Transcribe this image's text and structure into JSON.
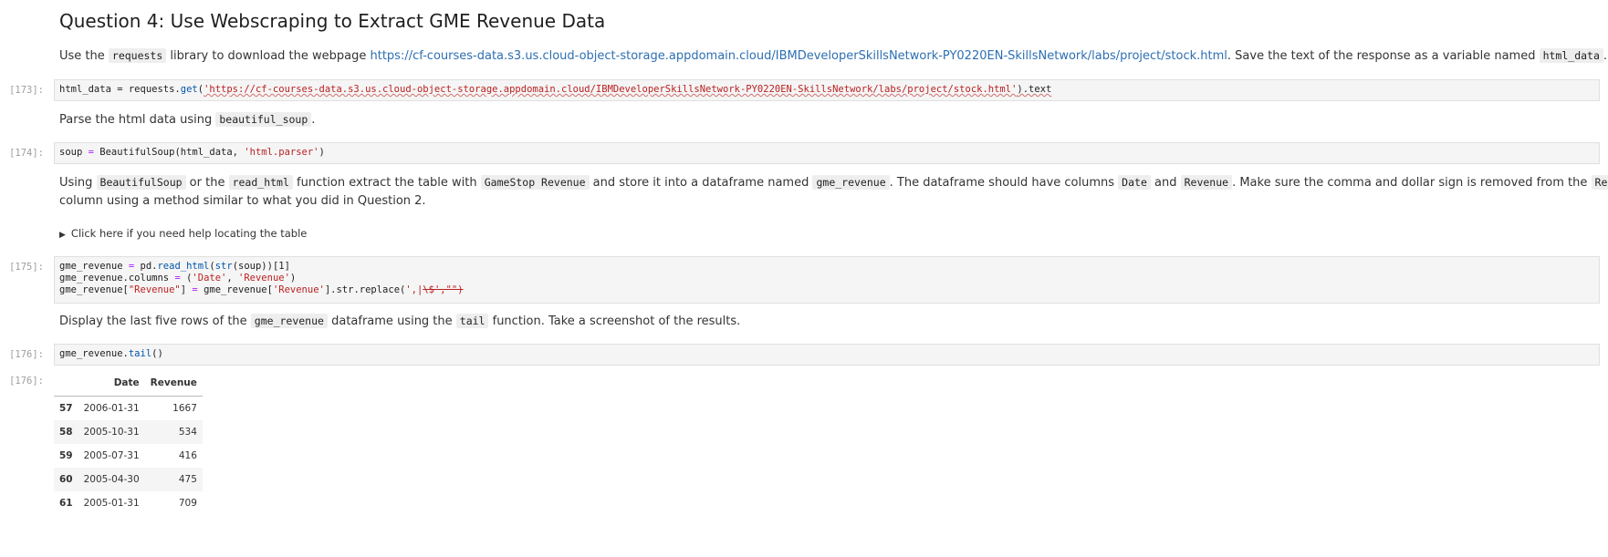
{
  "heading": "Question 4: Use Webscraping to Extract GME Revenue Data",
  "intro": {
    "p1": "Use the ",
    "code1": "requests",
    "p2": " library to download the webpage ",
    "link": "https://cf-courses-data.s3.us.cloud-object-storage.appdomain.cloud/IBMDeveloperSkillsNetwork-PY0220EN-SkillsNetwork/labs/project/stock.html",
    "p3": ". Save the text of the response as a variable named ",
    "code2": "html_data",
    "p4": "."
  },
  "cell173": {
    "prompt": "[173]:",
    "t1": "html_data = requests.",
    "t2": "get",
    "t3": "(",
    "t4": "'https://cf-courses-data.s3.us.cloud-object-storage.appdomain.cloud/IBMDeveloperSkillsNetwork-PY0220EN-SkillsNetwork/labs/project/stock.html'",
    "t5": ").text"
  },
  "parse": {
    "p1": "Parse the html data using ",
    "code": "beautiful_soup",
    "p2": "."
  },
  "cell174": {
    "prompt": "[174]:",
    "t1": "soup ",
    "t2": "=",
    "t3": " BeautifulSoup(html_data, ",
    "t4": "'html.parser'",
    "t5": ")"
  },
  "using": {
    "p1": "Using ",
    "c1": "BeautifulSoup",
    "p2": " or the ",
    "c2": "read_html",
    "p3": " function extract the table with ",
    "c3": "GameStop Revenue",
    "p4": " and store it into a dataframe named ",
    "c4": "gme_revenue",
    "p5": ". The dataframe should have columns ",
    "c5": "Date",
    "p6": " and ",
    "c6": "Revenue",
    "p7": ". Make sure the comma and dollar sign is removed from the ",
    "c7": "Revenue",
    "line2": "column using a method similar to what you did in Question 2."
  },
  "details": {
    "arrow": "▶",
    "summary": "Click here if you need help locating the table"
  },
  "cell175": {
    "prompt": "[175]:",
    "l1a": "gme_revenue ",
    "l1b": "=",
    "l1c": " pd.",
    "l1d": "read_html",
    "l1e": "(",
    "l1f": "str",
    "l1g": "(soup))[1]",
    "l2a": "gme_revenue.columns ",
    "l2b": "=",
    "l2c": " (",
    "l2d": "'Date'",
    "l2e": ", ",
    "l2f": "'Revenue'",
    "l2g": ")",
    "l3a": "gme_revenue[",
    "l3b": "\"Revenue\"",
    "l3c": "] ",
    "l3d": "=",
    "l3e": " gme_revenue[",
    "l3f": "'Revenue'",
    "l3g": "].str.replace(",
    "l3h": "',|",
    "l3i": "\\$',\"\")"
  },
  "display": {
    "p1": "Display the last five rows of the ",
    "c1": "gme_revenue",
    "p2": " dataframe using the ",
    "c2": "tail",
    "p3": " function. Take a screenshot of the results."
  },
  "cell176": {
    "prompt": "[176]:",
    "t1": "gme_revenue.",
    "t2": "tail",
    "t3": "()"
  },
  "output176": {
    "prompt": "[176]:",
    "columns": [
      "",
      "Date",
      "Revenue"
    ],
    "rows": [
      [
        "57",
        "2006-01-31",
        "1667"
      ],
      [
        "58",
        "2005-10-31",
        "534"
      ],
      [
        "59",
        "2005-07-31",
        "416"
      ],
      [
        "60",
        "2005-04-30",
        "475"
      ],
      [
        "61",
        "2005-01-31",
        "709"
      ]
    ]
  }
}
